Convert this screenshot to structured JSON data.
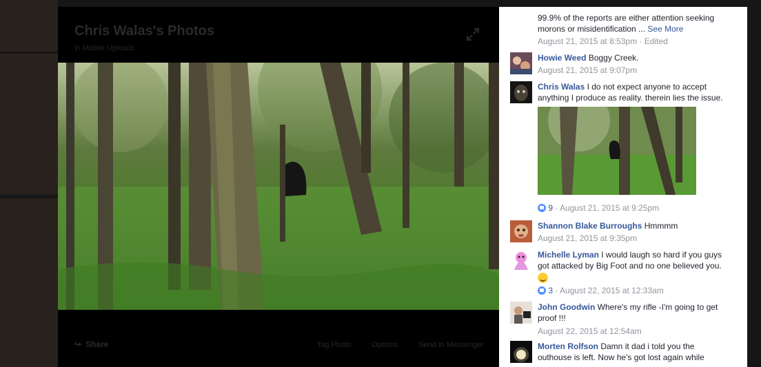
{
  "album": {
    "title": "Chris Walas's Photos",
    "subtitle": "in Mobile Uploads"
  },
  "photo_actions": {
    "share": "Share",
    "tag_photo": "Tag Photo",
    "options": "Options",
    "send_in_messenger": "Send in Messenger"
  },
  "comments": [
    {
      "author": "",
      "text": "99.9% of the reports are either attention seeking morons or misidentification ...",
      "see_more": "See More",
      "timestamp": "August 21, 2015 at 8:53pm",
      "edited": "Edited"
    },
    {
      "author": "Howie Weed",
      "text": "Boggy Creek.",
      "timestamp": "August 21, 2015 at 9:07pm"
    },
    {
      "author": "Chris Walas",
      "text": "I do not expect anyone to accept anything I produce as reality. therein lies the issue.",
      "reactions": "9",
      "timestamp": "August 21, 2015 at 9:25pm"
    },
    {
      "author": "Shannon Blake Burroughs",
      "text": "Hmmmm",
      "timestamp": "August 21, 2015 at 9:35pm"
    },
    {
      "author": "Michelle Lyman",
      "text": "I would laugh so hard if you guys got attacked by Big Foot and no one believed you.",
      "reactions": "3",
      "timestamp": "August 22, 2015 at 12:33am"
    },
    {
      "author": "John Goodwin",
      "text": "Where's my rifle -I'm going to get proof !!!",
      "timestamp": "August 22, 2015 at 12:54am"
    },
    {
      "author": "Morten Rolfson",
      "text": "Damn it dad i told you the outhouse is left. Now he's got lost again while"
    }
  ],
  "colors": {
    "link": "#365899",
    "meta": "#90949c",
    "like": "#5890ff"
  }
}
